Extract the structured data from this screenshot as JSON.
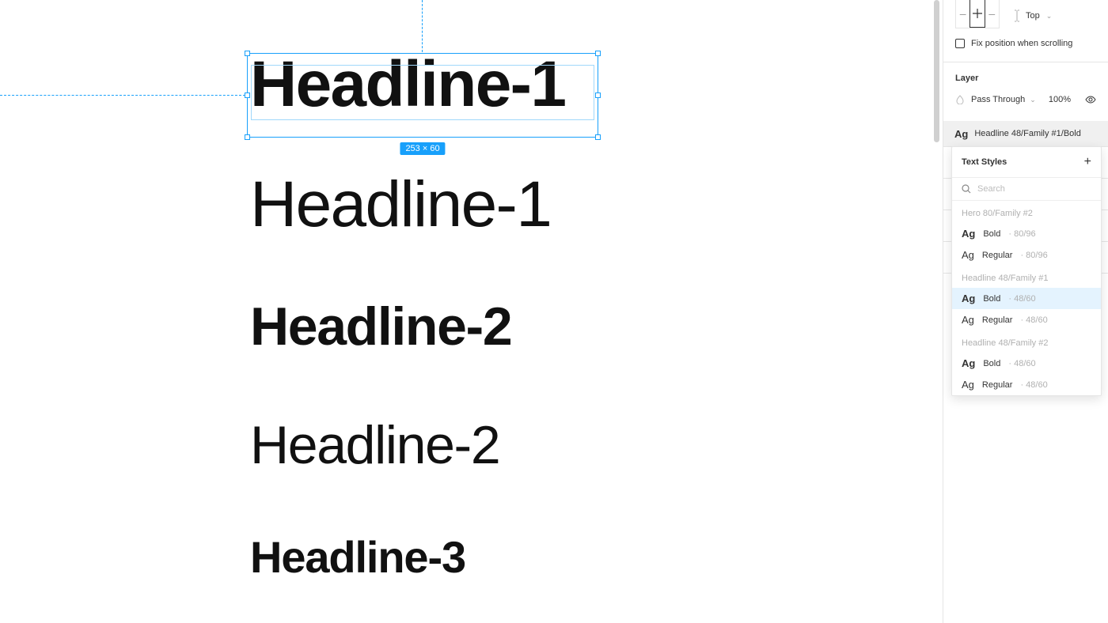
{
  "canvas": {
    "selection_dimensions": "253 × 60",
    "texts": {
      "h1_bold": "Headline-1",
      "h1_regular": "Headline-1",
      "h2_bold": "Headline-2",
      "h2_regular": "Headline-2",
      "h3_bold": "Headline-3"
    }
  },
  "panel": {
    "vertical_align": "Top",
    "fix_position_label": "Fix position when scrolling",
    "layer": {
      "title": "Layer",
      "blend_mode": "Pass Through",
      "opacity": "100%"
    },
    "applied_style": "Headline 48/Family #1/Bold"
  },
  "text_styles": {
    "title": "Text Styles",
    "search_placeholder": "Search",
    "groups": [
      {
        "label": "Hero 80/Family #2",
        "items": [
          {
            "name": "Bold",
            "meta": "80/96"
          },
          {
            "name": "Regular",
            "meta": "80/96"
          }
        ]
      },
      {
        "label": "Headline 48/Family #1",
        "items": [
          {
            "name": "Bold",
            "meta": "48/60",
            "selected": true
          },
          {
            "name": "Regular",
            "meta": "48/60"
          }
        ]
      },
      {
        "label": "Headline 48/Family #2",
        "items": [
          {
            "name": "Bold",
            "meta": "48/60"
          },
          {
            "name": "Regular",
            "meta": "48/60"
          }
        ]
      }
    ]
  }
}
